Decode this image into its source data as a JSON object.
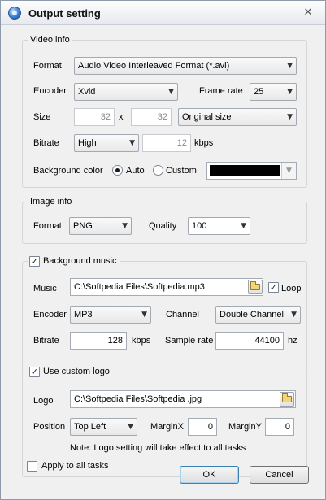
{
  "window": {
    "title": "Output setting",
    "close_glyph": "✕"
  },
  "video": {
    "legend": "Video info",
    "format_label": "Format",
    "format_value": "Audio Video Interleaved Format (*.avi)",
    "encoder_label": "Encoder",
    "encoder_value": "Xvid",
    "framerate_label": "Frame rate",
    "framerate_value": "25",
    "size_label": "Size",
    "size_w": "32",
    "size_x": "x",
    "size_h": "32",
    "size_preset": "Original size",
    "bitrate_label": "Bitrate",
    "bitrate_quality": "High",
    "bitrate_value": "12",
    "bitrate_unit": "kbps",
    "bgcolor_label": "Background color",
    "auto_label": "Auto",
    "custom_label": "Custom",
    "bgcolor_selected": "auto",
    "bgcolor_swatch": "#000000"
  },
  "image": {
    "legend": "Image info",
    "format_label": "Format",
    "format_value": "PNG",
    "quality_label": "Quality",
    "quality_value": "100"
  },
  "music": {
    "legend": "Background music",
    "enabled": true,
    "music_label": "Music",
    "music_path": "C:\\Softpedia Files\\Softpedia.mp3",
    "loop_label": "Loop",
    "loop_checked": true,
    "encoder_label": "Encoder",
    "encoder_value": "MP3",
    "channel_label": "Channel",
    "channel_value": "Double Channel",
    "bitrate_label": "Bitrate",
    "bitrate_value": "128",
    "bitrate_unit": "kbps",
    "samplerate_label": "Sample rate",
    "samplerate_value": "44100",
    "samplerate_unit": "hz"
  },
  "logo": {
    "legend": "Use custom logo",
    "enabled": true,
    "logo_label": "Logo",
    "logo_path": "C:\\Softpedia Files\\Softpedia .jpg",
    "position_label": "Position",
    "position_value": "Top Left",
    "marginx_label": "MarginX",
    "marginx_value": "0",
    "marginy_label": "MarginY",
    "marginy_value": "0",
    "note": "Note: Logo setting will take effect to all tasks"
  },
  "footer": {
    "apply_all_label": "Apply to all tasks",
    "apply_all_checked": false,
    "ok_label": "OK",
    "cancel_label": "Cancel"
  },
  "icons": {
    "check": "✓",
    "chevron": "▼"
  }
}
